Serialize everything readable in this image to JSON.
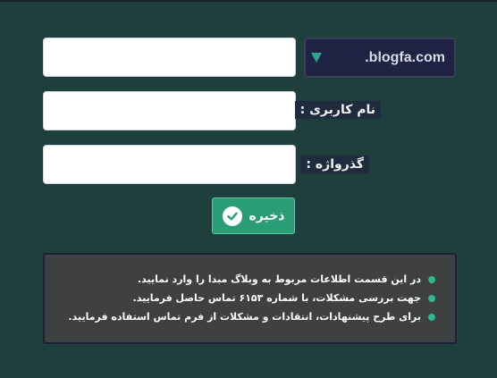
{
  "form": {
    "domain_value": "",
    "username_value": "",
    "password_value": "",
    "username_label": "نام کاربری :",
    "password_label": "گذرواژه :",
    "save_label": "ذخیره"
  },
  "domain_select": {
    "selected": ".blogfa.com"
  },
  "info": {
    "items": [
      "در این قسمت اطلاعات مربوط به وبلاگ مبدا را وارد نمایید.",
      "جهت بررسی مشکلات، با شماره ۶۱۵۳ تماس حاصل فرمایید.",
      "برای طرح پیشنهادات، انتقادات و مشکلات از فرم تماس استفاده فرمایید."
    ]
  },
  "colors": {
    "background": "#1f3f3c",
    "accent": "#2a9d77",
    "select_bg": "#1f2344",
    "info_bg": "#3e4041",
    "bullet": "#2eb88f"
  },
  "icons": {
    "save": "check-circle-icon",
    "select": "caret-down-icon",
    "bullet": "bullet-dot-icon"
  }
}
